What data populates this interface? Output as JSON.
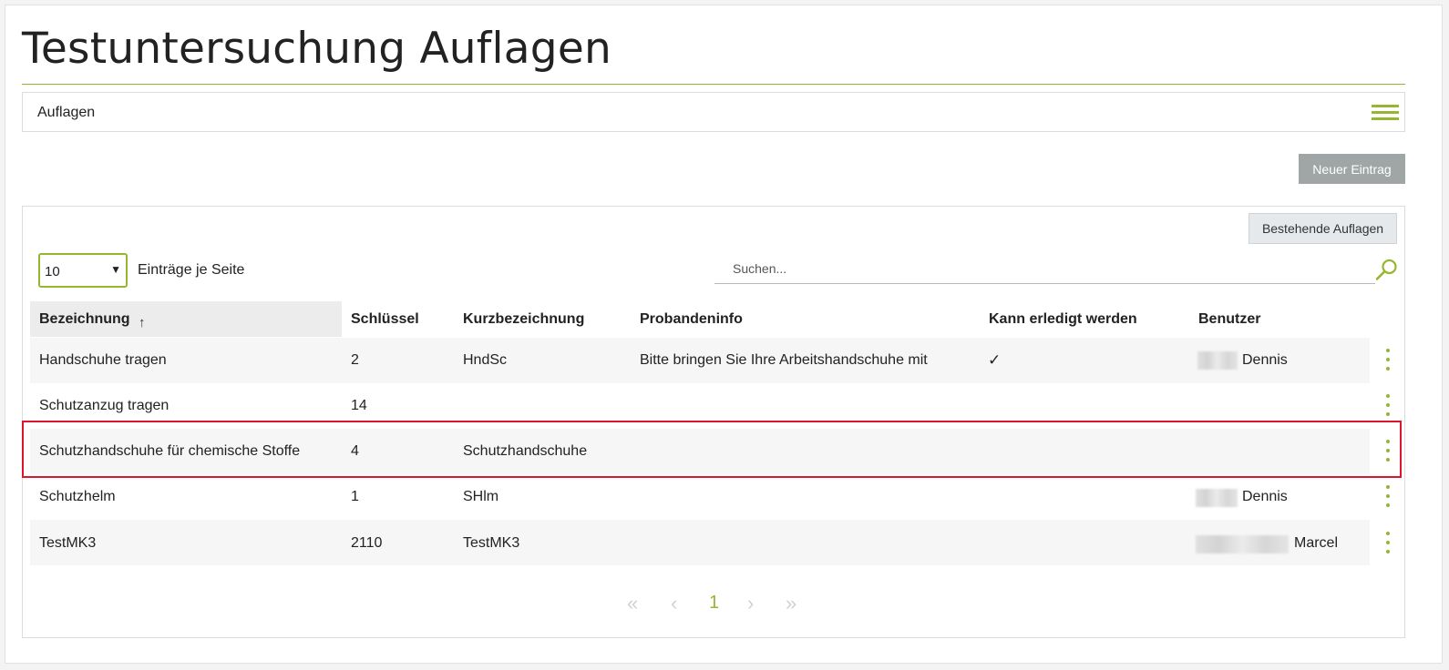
{
  "page": {
    "title": "Testuntersuchung Auflagen"
  },
  "subnav": {
    "title": "Auflagen",
    "menu_icon": "hamburger-menu-icon"
  },
  "toolbar": {
    "new_entry_label": "Neuer Eintrag",
    "existing_label": "Bestehende Auflagen"
  },
  "page_size": {
    "value": "10",
    "label": "Einträge je Seite"
  },
  "search": {
    "placeholder": "Suchen...",
    "icon": "search-icon"
  },
  "table": {
    "headers": {
      "bezeichnung": "Bezeichnung",
      "schluessel": "Schlüssel",
      "kurzbezeichnung": "Kurzbezeichnung",
      "probandeninfo": "Probandeninfo",
      "kann_erledigt": "Kann erledigt werden",
      "benutzer": "Benutzer"
    },
    "sort": {
      "column": "Bezeichnung",
      "direction": "ascending",
      "indicator": "↑"
    },
    "rows": [
      {
        "bezeichnung": "Handschuhe tragen",
        "schluessel": "2",
        "kurzbezeichnung": "HndSc",
        "probandeninfo": "Bitte bringen Sie Ihre Arbeitshandschuhe mit",
        "kann_erledigt": "✓",
        "benutzer": "Dennis"
      },
      {
        "bezeichnung": "Schutzanzug tragen",
        "schluessel": "14",
        "kurzbezeichnung": "",
        "probandeninfo": "",
        "kann_erledigt": "",
        "benutzer": ""
      },
      {
        "bezeichnung": "Schutzhandschuhe für chemische Stoffe",
        "schluessel": "4",
        "kurzbezeichnung": "Schutzhandschuhe",
        "probandeninfo": "",
        "kann_erledigt": "",
        "benutzer": "",
        "highlighted": true
      },
      {
        "bezeichnung": "Schutzhelm",
        "schluessel": "1",
        "kurzbezeichnung": "SHlm",
        "probandeninfo": "",
        "kann_erledigt": "",
        "benutzer": "Dennis"
      },
      {
        "bezeichnung": "TestMK3",
        "schluessel": "2110",
        "kurzbezeichnung": "TestMK3",
        "probandeninfo": "",
        "kann_erledigt": "",
        "benutzer": "Marcel"
      }
    ]
  },
  "pagination": {
    "first": "«",
    "prev": "‹",
    "current": "1",
    "next": "›",
    "last": "»"
  },
  "colors": {
    "accent": "#95b62f",
    "highlight_border": "#e0142c",
    "button_gray": "#a0a6a6"
  }
}
